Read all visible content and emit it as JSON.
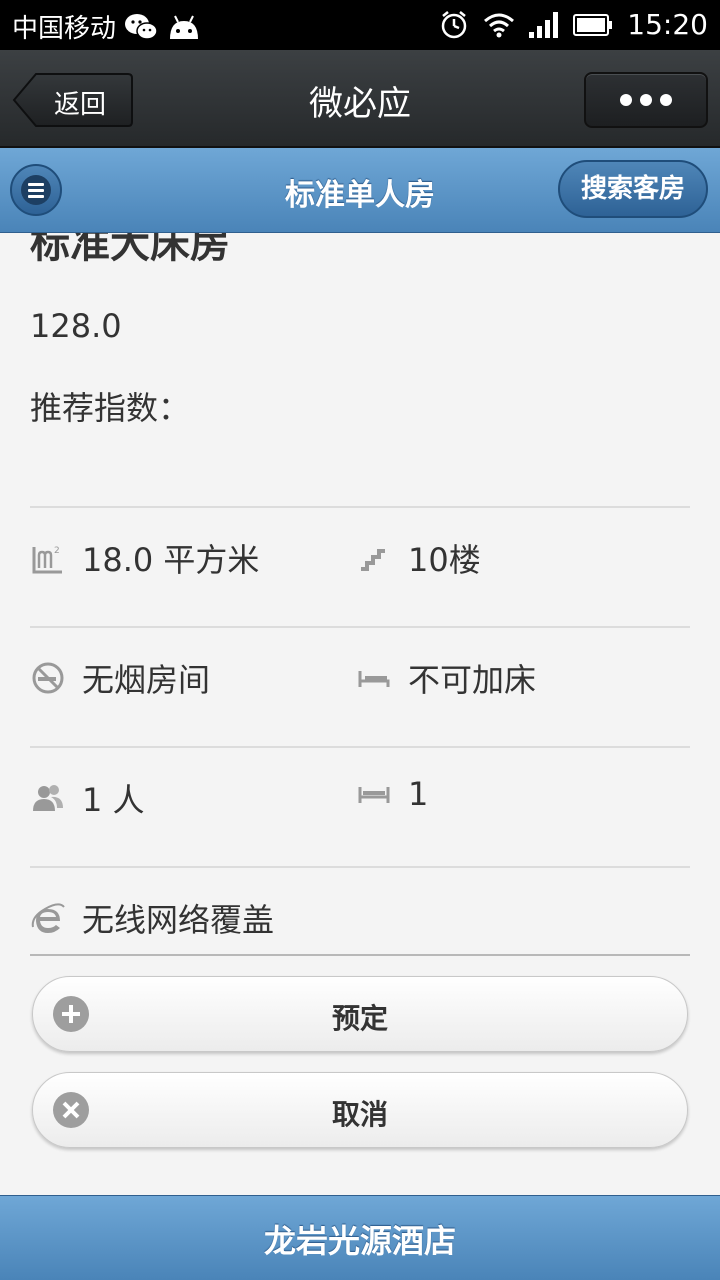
{
  "status_bar": {
    "carrier": "中国移动",
    "time": "15:20"
  },
  "wechat_bar": {
    "back_label": "返回",
    "title": "微必应"
  },
  "page_header": {
    "title": "标准单人房",
    "search_label": "搜索客房"
  },
  "room": {
    "name": "标准大床房",
    "price": "128.0",
    "recommend_label": "推荐指数："
  },
  "features": {
    "area": "18.0 平方米",
    "floor": "10楼",
    "smoking": "无烟房间",
    "extra_bed": "不可加床",
    "occupancy": "1 人",
    "beds": "1",
    "wifi": "无线网络覆盖"
  },
  "actions": {
    "book_label": "预定",
    "cancel_label": "取消"
  },
  "footer": {
    "title": "龙岩光源酒店"
  },
  "colors": {
    "header_blue": "#5b95c8",
    "wechat_dark": "#2e3134",
    "icon_gray": "#9e9e9e"
  }
}
